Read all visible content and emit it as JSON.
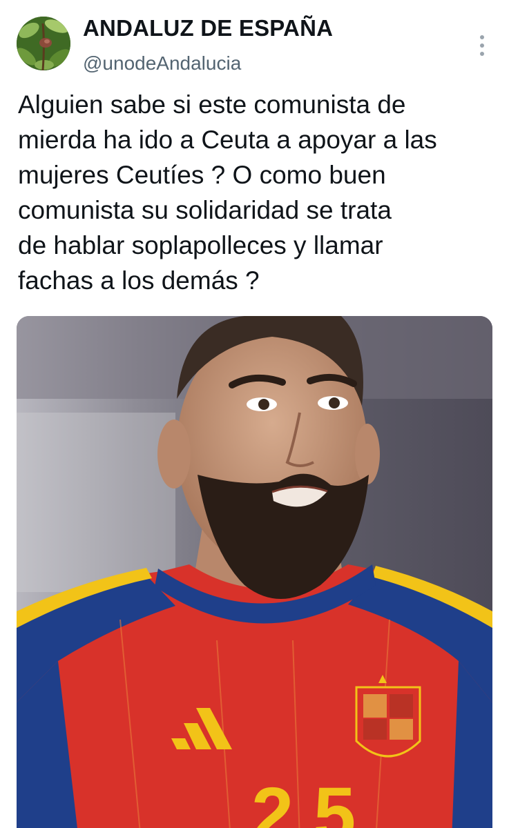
{
  "author": {
    "display_name": "ANDALUZ DE ESPAÑA",
    "handle": "@unodeAndalucia",
    "avatar_icon": "avocado-tree-avatar"
  },
  "menu": {
    "icon": "more-vertical-icon"
  },
  "tweet": {
    "text": "Alguien sabe si este comunista de\nmierda ha ido a Ceuta a apoyar a las\nmujeres Ceutíes ? O como buen\ncomunista su solidaridad se trata\nde hablar soplapolleces y  llamar\nfachas a los demás ?"
  },
  "media": {
    "kind": "photo",
    "subject": "player-in-spain-national-team-jersey",
    "colors": {
      "jersey_red": "#d8322a",
      "jersey_navy": "#1f3f8a",
      "jersey_yellow": "#f2c318",
      "skin": "#c99a7e",
      "beard": "#2a1d16",
      "background": "#6b6a76"
    }
  },
  "theme": {
    "text_primary": "#0f1419",
    "text_secondary": "#536471",
    "background": "#ffffff"
  }
}
